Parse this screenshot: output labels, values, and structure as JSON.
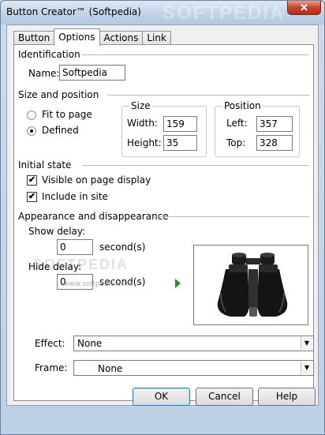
{
  "window": {
    "title": "Button Creator™ (Softpedia)",
    "watermark": "SOFTPEDIA",
    "close_glyph": "✕"
  },
  "tabs": [
    {
      "label": "Button",
      "active": false
    },
    {
      "label": "Options",
      "active": true
    },
    {
      "label": "Actions",
      "active": false
    },
    {
      "label": "Link",
      "active": false
    }
  ],
  "identification": {
    "section_label": "Identification",
    "name_label": "Name:",
    "name_value": "Softpedia"
  },
  "size_position": {
    "section_label": "Size and position",
    "fit_to_page_label": "Fit to page",
    "defined_label": "Defined",
    "selected": "Defined",
    "size_group": {
      "title": "Size",
      "width_label": "Width:",
      "width_value": "159",
      "height_label": "Height:",
      "height_value": "35"
    },
    "position_group": {
      "title": "Position",
      "left_label": "Left:",
      "left_value": "357",
      "top_label": "Top:",
      "top_value": "328"
    }
  },
  "initial_state": {
    "section_label": "Initial state",
    "visible_label": "Visible on page display",
    "visible_checked": true,
    "include_label": "Include in site",
    "include_checked": true
  },
  "appearance": {
    "section_label": "Appearance and disappearance",
    "show_delay_label": "Show delay:",
    "show_delay_value": "0",
    "show_delay_unit": "second(s)",
    "hide_delay_label": "Hide delay:",
    "hide_delay_value": "0",
    "hide_delay_unit": "second(s)",
    "preview_watermark": "SOFTPEDIA",
    "preview_watermark_small": "www.softpedia.com"
  },
  "effect": {
    "label": "Effect:",
    "value": "None"
  },
  "frame": {
    "label": "Frame:",
    "value": "None"
  },
  "buttons": {
    "ok": "OK",
    "cancel": "Cancel",
    "help": "Help"
  },
  "colors": {
    "accent": "#3c7fb1",
    "play_arrow": "#2f8a2f",
    "close": "#c7432a"
  }
}
